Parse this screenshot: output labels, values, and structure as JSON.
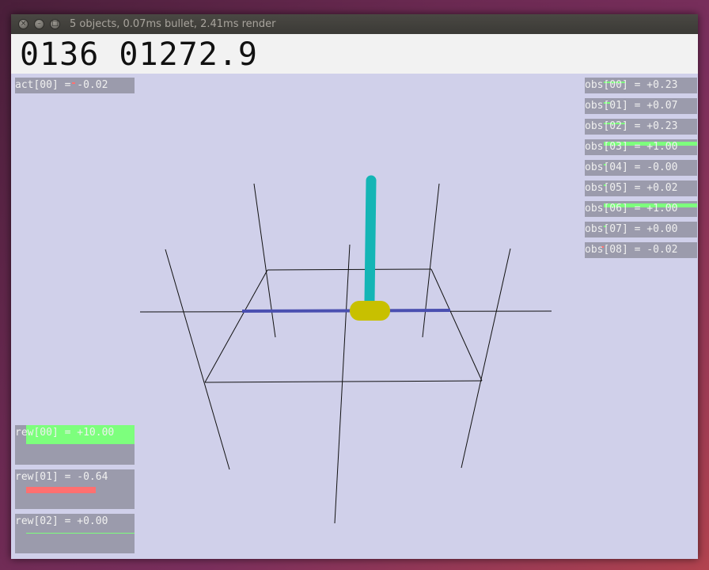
{
  "window": {
    "title": "5 objects, 0.07ms bullet, 2.41ms render",
    "close_glyph": "×",
    "minimize_glyph": "–",
    "maximize_glyph": "□"
  },
  "counter": {
    "text": "0136 01272.9"
  },
  "action_panel": {
    "label": "act[00] = -0.02",
    "value": -0.02
  },
  "observations": [
    {
      "label": "obs[00] = +0.23",
      "value": 0.23
    },
    {
      "label": "obs[01] = +0.07",
      "value": 0.07
    },
    {
      "label": "obs[02] = +0.23",
      "value": 0.23
    },
    {
      "label": "obs[03] = +1.00",
      "value": 1.0
    },
    {
      "label": "obs[04] = -0.00",
      "value": 0.0
    },
    {
      "label": "obs[05] = +0.02",
      "value": 0.02
    },
    {
      "label": "obs[06] = +1.00",
      "value": 1.0
    },
    {
      "label": "obs[07] = +0.00",
      "value": 0.0
    },
    {
      "label": "obs[08] = -0.02",
      "value": -0.02
    }
  ],
  "rewards": [
    {
      "label": "rew[00] = +10.00",
      "value": 10.0
    },
    {
      "label": "rew[01] = -0.64",
      "value": -0.64
    },
    {
      "label": "rew[02] = +0.00",
      "value": 0.0
    }
  ],
  "colors": {
    "background": "#d0d0ea",
    "panel": "#9b9bac",
    "positive_bar": "#7dff7d",
    "negative_bar": "#ff7070",
    "pole": "#14b5b5",
    "cart": "#c8c000",
    "rail": "#4a4fb0",
    "grid_lines": "#111111"
  },
  "scene": {
    "icon": "cartpole-3d-scene"
  }
}
